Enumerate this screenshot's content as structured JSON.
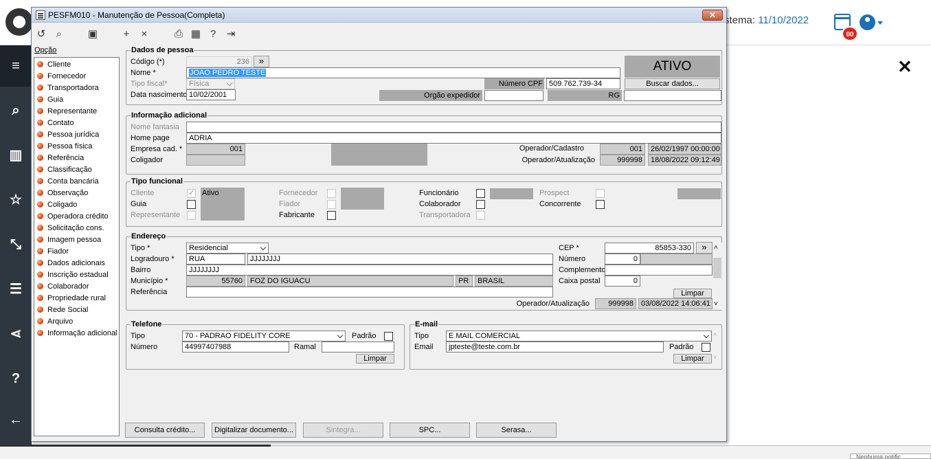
{
  "background": {
    "system_date_label": "stema: ",
    "system_date_value": "11/10/2022",
    "notification_count": "00",
    "close_glyph": "✕",
    "bottom_notification": "Nenhuma notific"
  },
  "window": {
    "title": "PESFM010 - Manutenção de Pessoa(Completa)",
    "close_label": "✕"
  },
  "toolbar": {
    "icons": [
      "undo-icon",
      "search-icon",
      "save-icon",
      "add-icon",
      "cancel-icon",
      "print-icon",
      "calendar-icon",
      "help-icon",
      "exit-icon"
    ]
  },
  "options": {
    "title": "Opção",
    "items": [
      "Cliente",
      "Fornecedor",
      "Transportadora",
      "Guia",
      "Representante",
      "Contato",
      "Pessoa jurídica",
      "Pessoa física",
      "Referência",
      "Classificação",
      "Conta bancária",
      "Observação",
      "Coligado",
      "Operadora crédito",
      "Solicitação cons.",
      "Imagem pessoa",
      "Fiador",
      "Dados adicionais",
      "Inscrição estadual",
      "Colaborador",
      "Propriedade rural",
      "Rede Social",
      "Arquivo",
      "Informação adicional"
    ]
  },
  "dados": {
    "title": "Dados de pessoa",
    "codigo_label": "Código (*)",
    "codigo_value": "236",
    "codigo_btn": "»",
    "nome_label": "Nome *",
    "nome_value": "JOAO PEDRO TESTE",
    "tipo_fiscal_label": "Tipo fiscal*",
    "tipo_fiscal_value": "Física",
    "data_nasc_label": "Data nascimento",
    "data_nasc_value": "10/02/2001",
    "status": "ATIVO",
    "cpf_label": "Número CPF",
    "cpf_value": "509.762.739-34",
    "buscar_btn": "Buscar dados...",
    "orgao_label": "Orgão expedidor",
    "orgao_value": "",
    "rg_label": "RG",
    "rg_value": ""
  },
  "info": {
    "title": "Informação adicional",
    "nome_fantasia_label": "Nome fantasia",
    "nome_fantasia_value": "",
    "home_page_label": "Home page",
    "home_page_value": "ADRIA",
    "empresa_label": "Empresa cad. *",
    "empresa_value": "001",
    "coligador_label": "Coligador",
    "coligador_value": "",
    "operador_cadastro_label": "Operador/Cadastro",
    "operador_cadastro_code": "001",
    "operador_cadastro_date": "26/02/1997 00:00:00",
    "operador_atualizacao_label": "Operador/Atualização",
    "operador_atualizacao_code": "999998",
    "operador_atualizacao_date": "18/08/2022 09:12:49"
  },
  "tipo_funcional": {
    "title": "Tipo funcional",
    "cliente_label": "Cliente",
    "cliente_status": "Ativo",
    "guia_label": "Guia",
    "representante_label": "Representante",
    "fornecedor_label": "Fornecedor",
    "fiador_label": "Fiador",
    "fabricante_label": "Fabricante",
    "funcionario_label": "Funcionário",
    "colaborador_label": "Colaborador",
    "transportadora_label": "Transportadora",
    "prospect_label": "Prospect",
    "concorrente_label": "Concorrente"
  },
  "endereco": {
    "title": "Endereço",
    "tipo_label": "Tipo *",
    "tipo_value": "Residencial",
    "logradouro_label": "Logradouro *",
    "logradouro_tipo": "RUA",
    "logradouro_value": "JJJJJJJJ",
    "bairro_label": "Bairro",
    "bairro_value": "JJJJJJJJ",
    "municipio_label": "Município *",
    "municipio_code": "55760",
    "municipio_name": "FOZ DO IGUACU",
    "uf": "PR",
    "pais": "BRASIL",
    "referencia_label": "Referência",
    "referencia_value": "",
    "cep_label": "CEP *",
    "cep_value": "85853-330",
    "cep_btn": "»",
    "numero_label": "Número",
    "numero_value": "0",
    "complemento_label": "Complemento",
    "complemento_value": "",
    "caixa_postal_label": "Caixa postal",
    "caixa_postal_value": "0",
    "limpar_btn": "Limpar",
    "operador_label": "Operador/Atualização",
    "operador_code": "999998",
    "operador_date": "03/08/2022 14:06:41"
  },
  "telefone": {
    "title": "Telefone",
    "tipo_label": "Tipo",
    "tipo_value": "70 - PADRAO FIDELITY CORE",
    "padrao_label": "Padrão",
    "numero_label": "Número",
    "numero_value": "44997407988",
    "ramal_label": "Ramal",
    "ramal_value": "",
    "limpar_btn": "Limpar"
  },
  "email": {
    "title": "E-mail",
    "tipo_label": "Tipo",
    "tipo_value": "E MAIL COMERCIAL",
    "email_label": "Email",
    "email_value": "jpteste@teste.com.br",
    "padrao_label": "Padrão",
    "limpar_btn": "Limpar"
  },
  "bottom_buttons": [
    "Consulta crédito...",
    "Digitalizar documento...",
    "Sintegra...",
    "SPC...",
    "Serasa..."
  ]
}
